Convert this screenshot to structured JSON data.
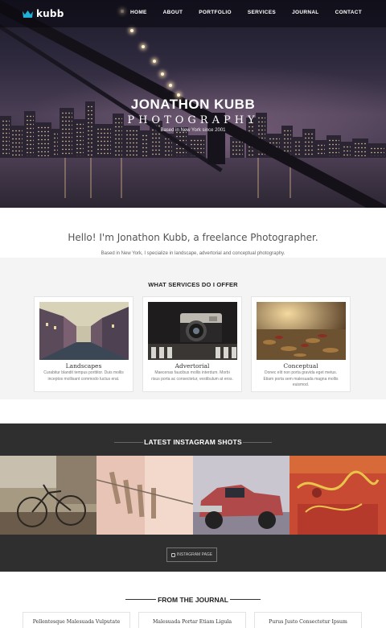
{
  "nav": {
    "logo_text": "kubb",
    "items": [
      "HOME",
      "ABOUT",
      "PORTFOLIO",
      "SERVICES",
      "JOURNAL",
      "CONTACT"
    ]
  },
  "hero": {
    "title": "JONATHON KUBB",
    "subtitle": "PHOTOGRAPHY",
    "note": "Based in New York since 2001"
  },
  "intro": {
    "heading": "Hello! I'm Jonathon Kubb, a freelance Photographer.",
    "text": "Based in New York, I specialize in landscape, advertorial and conceptual photography."
  },
  "services": {
    "heading": "WHAT SERVICES DO I OFFER",
    "cards": [
      {
        "title": "Landscapes",
        "desc": "Curabitur blandit tempus porttitor. Duis mollis inceptos mollisant commodo luctus erat."
      },
      {
        "title": "Advertorial",
        "desc": "Maecenas faucibus mollis interdum. Morbi risus porta ac consectetur, vestibulum at eros."
      },
      {
        "title": "Conceptual",
        "desc": "Donec elit non porta gravida eget metus. Etiam porta sem malesuada magna mollis euismod."
      }
    ]
  },
  "instagram": {
    "heading": "LATEST INSTAGRAM SHOTS",
    "button": "INSTAGRAM PAGE"
  },
  "journal": {
    "heading": "FROM THE JOURNAL",
    "posts": [
      "Pellentesque Malesuada Vulputate",
      "Malesuada Portar Etiam Ligula",
      "Purus Justo Consectetur Ipsum"
    ]
  },
  "colors": {
    "accent": "#1fb1d8",
    "dark_band": "#2f2f2f",
    "services_bg": "#f4f4f4"
  }
}
